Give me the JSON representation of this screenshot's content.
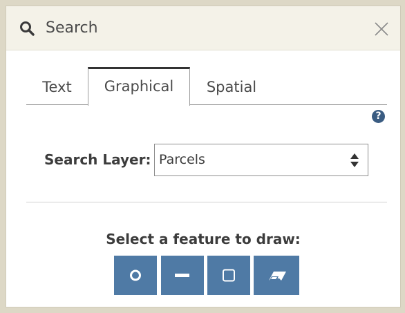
{
  "panel": {
    "title": "Search",
    "title_icon": "search-icon",
    "close_icon": "close-icon"
  },
  "tabs": [
    {
      "label": "Text",
      "active": false
    },
    {
      "label": "Graphical",
      "active": true
    },
    {
      "label": "Spatial",
      "active": false
    }
  ],
  "help": {
    "icon": "help-icon",
    "glyph": "?"
  },
  "search_layer": {
    "label": "Search Layer:",
    "selected": "Parcels"
  },
  "draw": {
    "label": "Select a feature to draw:",
    "tools": [
      {
        "name": "circle-tool",
        "icon": "circle-icon"
      },
      {
        "name": "line-tool",
        "icon": "line-icon"
      },
      {
        "name": "rectangle-tool",
        "icon": "square-icon"
      },
      {
        "name": "erase-tool",
        "icon": "eraser-icon"
      }
    ]
  },
  "colors": {
    "button_fill": "#4f7aa5",
    "help_fill": "#3a5c82",
    "header_bg": "#f4f2e8",
    "outer_bg": "#ddd8c6"
  }
}
